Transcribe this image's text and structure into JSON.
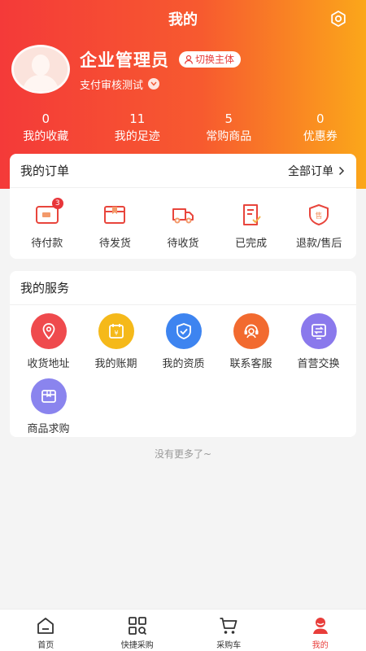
{
  "header": {
    "title": "我的"
  },
  "profile": {
    "name": "企业管理员",
    "switch_label": "切换主体",
    "company": "支付审核测试"
  },
  "stats": [
    {
      "value": "0",
      "label": "我的收藏"
    },
    {
      "value": "11",
      "label": "我的足迹"
    },
    {
      "value": "5",
      "label": "常购商品"
    },
    {
      "value": "0",
      "label": "优惠券"
    }
  ],
  "orders": {
    "title": "我的订单",
    "all_label": "全部订单",
    "items": [
      {
        "label": "待付款",
        "badge": "3",
        "icon": "wallet-icon"
      },
      {
        "label": "待发货",
        "icon": "package-icon"
      },
      {
        "label": "待收货",
        "icon": "truck-icon"
      },
      {
        "label": "已完成",
        "icon": "document-check-icon"
      },
      {
        "label": "退款/售后",
        "icon": "after-sale-icon"
      }
    ]
  },
  "services": {
    "title": "我的服务",
    "items": [
      {
        "label": "收货地址",
        "icon": "location-icon",
        "color": "#ef4a4d"
      },
      {
        "label": "我的账期",
        "icon": "calendar-yen-icon",
        "color": "#f5b91a"
      },
      {
        "label": "我的资质",
        "icon": "shield-check-icon",
        "color": "#3d84f0"
      },
      {
        "label": "联系客服",
        "icon": "customer-service-icon",
        "color": "#f26a2f"
      },
      {
        "label": "首营交换",
        "icon": "exchange-icon",
        "color": "#8a79ec"
      },
      {
        "label": "商品求购",
        "icon": "box-icon",
        "color": "#8a84ee"
      }
    ]
  },
  "footer_note": "没有更多了~",
  "tabbar": [
    {
      "label": "首页",
      "icon": "home-icon"
    },
    {
      "label": "快捷采购",
      "icon": "qr-scan-icon"
    },
    {
      "label": "采购车",
      "icon": "cart-icon"
    },
    {
      "label": "我的",
      "icon": "user-icon",
      "active": true
    }
  ]
}
